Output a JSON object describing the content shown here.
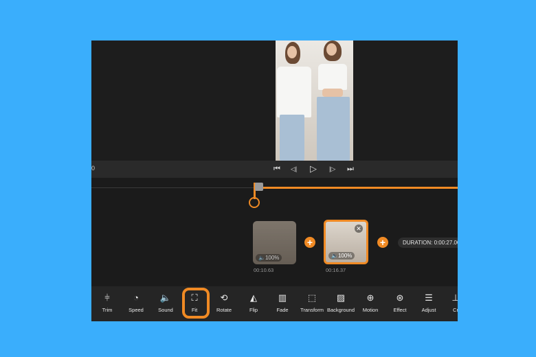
{
  "player": {
    "timecode": "0",
    "controls": [
      {
        "name": "skip-to-start-icon",
        "glyph": "⏮"
      },
      {
        "name": "prev-frame-icon",
        "glyph": "◁|"
      },
      {
        "name": "play-icon",
        "glyph": "▷"
      },
      {
        "name": "next-frame-icon",
        "glyph": "|▷"
      },
      {
        "name": "skip-to-end-icon",
        "glyph": "⏭"
      }
    ]
  },
  "timeline": {
    "clips": [
      {
        "volume": "🔈100%",
        "duration": "00:10.63"
      },
      {
        "volume": "🔈100%",
        "duration": "00:16.37"
      }
    ],
    "add_glyph": "+",
    "total_duration": "DURATION: 0:00:27.00"
  },
  "toolbar": {
    "tools": [
      {
        "label": "Trim",
        "icon": "trim-icon",
        "glyph": "⫩"
      },
      {
        "label": "Speed",
        "icon": "speed-icon",
        "glyph": "◔"
      },
      {
        "label": "Sound",
        "icon": "sound-icon",
        "glyph": "🔈"
      },
      {
        "label": "Fit",
        "icon": "fit-icon",
        "glyph": "⛶"
      },
      {
        "label": "Rotate",
        "icon": "rotate-icon",
        "glyph": "⟲"
      },
      {
        "label": "Flip",
        "icon": "flip-icon",
        "glyph": "◭"
      },
      {
        "label": "Fade",
        "icon": "fade-icon",
        "glyph": "▥"
      },
      {
        "label": "Transform",
        "icon": "transform-icon",
        "glyph": "⬚"
      },
      {
        "label": "Background",
        "icon": "background-icon",
        "glyph": "▨"
      },
      {
        "label": "Motion",
        "icon": "motion-icon",
        "glyph": "⊕"
      },
      {
        "label": "Effect",
        "icon": "effect-icon",
        "glyph": "⊛"
      },
      {
        "label": "Adjust",
        "icon": "adjust-icon",
        "glyph": "☰"
      },
      {
        "label": "Cr",
        "icon": "crop-icon",
        "glyph": "⊥"
      }
    ]
  },
  "colors": {
    "accent": "#f08a24",
    "page_background": "#3aaefc",
    "panel": "#1c1c1c"
  }
}
